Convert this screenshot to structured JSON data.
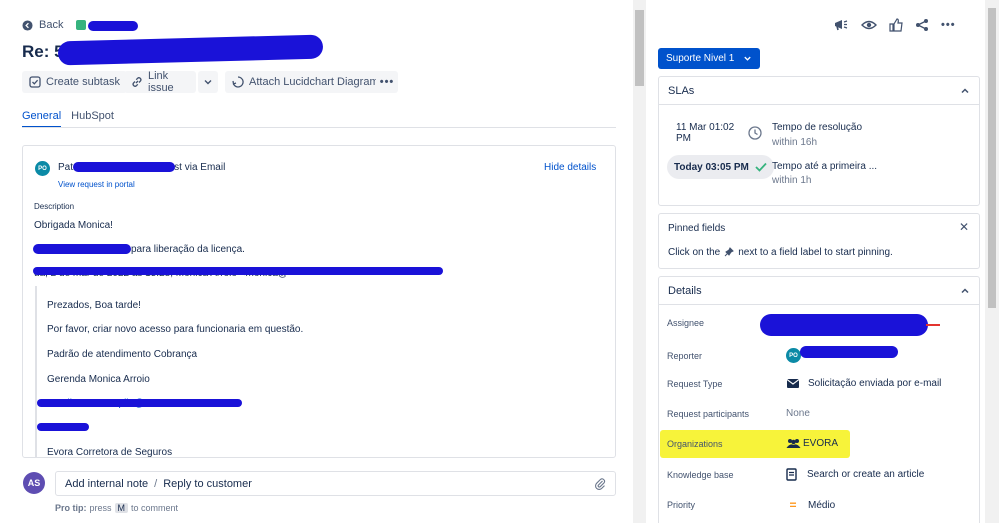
{
  "header": {
    "back_label": "Back",
    "title": "Re: 5"
  },
  "toolbar": {
    "create_subtask": "Create subtask",
    "link_issue": "Link issue",
    "attach_diagram": "Attach Lucidchart Diagram"
  },
  "tabs": [
    "General",
    "HubSpot"
  ],
  "activity": {
    "avatar_initials": "PO",
    "author_fragment": "Patricia Olivei",
    "action": "d this request via Email",
    "view_request": "View request in portal",
    "hide_details": "Hide details",
    "description_label": "Description",
    "lines": [
      "Obrigada Monica!",
      "para liberação da licença.",
      "ua, 2 de mar de 2022 às 15:28, Monica Arroio <monica@"
    ],
    "quoted_lines": [
      "Prezados, Boa tarde!",
      "Por favor, criar novo acesso para funcionaria em questão.",
      "Padrão de atendimento Cobrança",
      "Gerenda Monica Arroio",
      "Email: Vanessa.pila@evor",
      "Evora Corretora de Seguros"
    ]
  },
  "composer": {
    "avatar_initials": "AS",
    "add_note": "Add internal note",
    "separator": "/",
    "reply": "Reply to customer",
    "protip_label": "Pro tip:",
    "protip_press": "press",
    "protip_key": "M",
    "protip_suffix": "to comment"
  },
  "status": {
    "label": "Suporte Nivel 1"
  },
  "slas": {
    "title": "SLAs",
    "items": [
      {
        "time": "11 Mar 01:02 PM",
        "name": "Tempo de resolução",
        "remaining": "within 16h"
      },
      {
        "time": "Today 03:05 PM",
        "name": "Tempo até a primeira ...",
        "remaining": "within 1h"
      }
    ]
  },
  "pinned": {
    "title": "Pinned fields",
    "hint_pre": "Click on the",
    "hint_post": "next to a field label to start pinning."
  },
  "details": {
    "title": "Details",
    "assignee_label": "Assignee",
    "reporter_label": "Reporter",
    "reporter_initials": "PO",
    "request_type_label": "Request Type",
    "request_type_value": "Solicitação enviada por e-mail",
    "participants_label": "Request participants",
    "participants_value": "None",
    "organizations_label": "Organizations",
    "organizations_value": "EVORA",
    "kb_label": "Knowledge base",
    "kb_value": "Search or create an article",
    "priority_label": "Priority",
    "priority_value": "Médio",
    "priority_glyph": "="
  },
  "colors": {
    "accent": "#0052cc",
    "redaction": "#1a12d8",
    "highlight": "#f7f33a",
    "priority": "#ff991f"
  }
}
